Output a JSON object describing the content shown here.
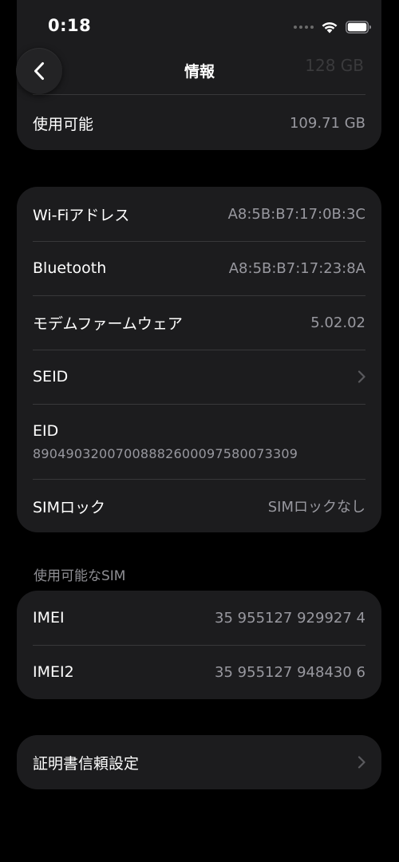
{
  "status_bar": {
    "time": "0:18"
  },
  "nav": {
    "title": "情報"
  },
  "storage_card": {
    "partial_value": "128 GB",
    "rows": [
      {
        "label": "使用可能",
        "value": "109.71 GB"
      }
    ]
  },
  "network_card": {
    "rows": [
      {
        "label": "Wi-Fiアドレス",
        "value": "A8:5B:B7:17:0B:3C"
      },
      {
        "label": "Bluetooth",
        "value": "A8:5B:B7:17:23:8A"
      },
      {
        "label": "モデムファームウェア",
        "value": "5.02.02"
      },
      {
        "label": "SEID"
      },
      {
        "label": "EID",
        "value": "89049032007008882600097580073309"
      },
      {
        "label": "SIMロック",
        "value": "SIMロックなし"
      }
    ]
  },
  "sim_section": {
    "header": "使用可能なSIM"
  },
  "imei_card": {
    "rows": [
      {
        "label": "IMEI",
        "value": "35 955127 929927 4"
      },
      {
        "label": "IMEI2",
        "value": "35 955127 948430 6"
      }
    ]
  },
  "cert_card": {
    "label": "証明書信頼設定"
  },
  "icons": {
    "back": "chevron-left-icon",
    "disclosure": "chevron-right-icon",
    "wifi": "wifi-icon",
    "battery": "battery-icon"
  },
  "colors": {
    "background": "#000000",
    "card": "#1c1c1e",
    "secondary_text": "#98989f",
    "separator": "#38383a"
  }
}
